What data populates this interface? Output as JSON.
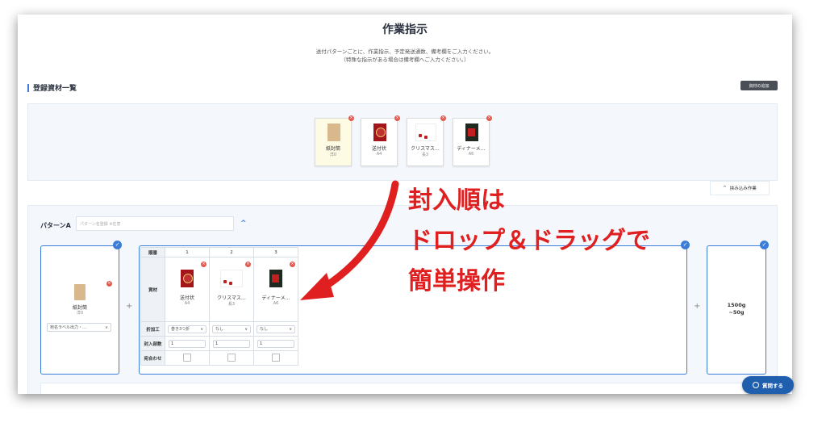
{
  "page": {
    "title": "作業指示",
    "description_line1": "送付パターンごとに、作業指示、予定発送通数、備考欄をご入力ください。",
    "description_line2": "（特殊な指示がある場合は備考欄へご入力ください。）"
  },
  "materials": {
    "heading": "登録資材一覧",
    "list_button": "資材の追加",
    "items": [
      {
        "name": "紙封筒",
        "size": "洋0",
        "thumb": "kraft-envelope"
      },
      {
        "name": "送付状",
        "size": "A4",
        "thumb": "red-card"
      },
      {
        "name": "クリスマス…",
        "size": "長3",
        "thumb": "white-christmas-card"
      },
      {
        "name": "ディナーメ…",
        "size": "A6",
        "thumb": "dark-dinner-card"
      }
    ],
    "toggle_label": "挟み込み作業"
  },
  "pattern": {
    "label": "パターンA",
    "name_placeholder": "パターン名登録 ※任意",
    "envelope": {
      "name": "紙封筒",
      "size": "洋0",
      "select_value": "宛名ラベル出力・…"
    },
    "table": {
      "row_headers": [
        "順番",
        "資材",
        "折加工",
        "封入部数",
        "宛合わせ"
      ],
      "columns": [
        {
          "order": "1",
          "name": "送付状",
          "size": "A4",
          "fold": "巻き3つ折",
          "count": "1"
        },
        {
          "order": "2",
          "name": "クリスマス…",
          "size": "長3",
          "fold": "なし",
          "count": "1"
        },
        {
          "order": "3",
          "name": "ディナーメ…",
          "size": "A6",
          "fold": "なし",
          "count": "1"
        }
      ]
    },
    "weight": {
      "line1": "1500g",
      "line2": "~50g"
    }
  },
  "help_button": "質問する",
  "annotation": {
    "line1": "封入順は",
    "line2": "ドロップ＆ドラッグで",
    "line3": "簡単操作",
    "color": "#e02020"
  },
  "icons": {
    "close": "×",
    "check": "✓",
    "plus": "+",
    "chevron_up": "^",
    "chevron_down": "∨",
    "chat": "chat-bubble-icon"
  },
  "colors": {
    "accent": "#3b7dd8",
    "danger": "#e05a4f",
    "help_button": "#1f5fae",
    "annotation": "#e02020"
  }
}
